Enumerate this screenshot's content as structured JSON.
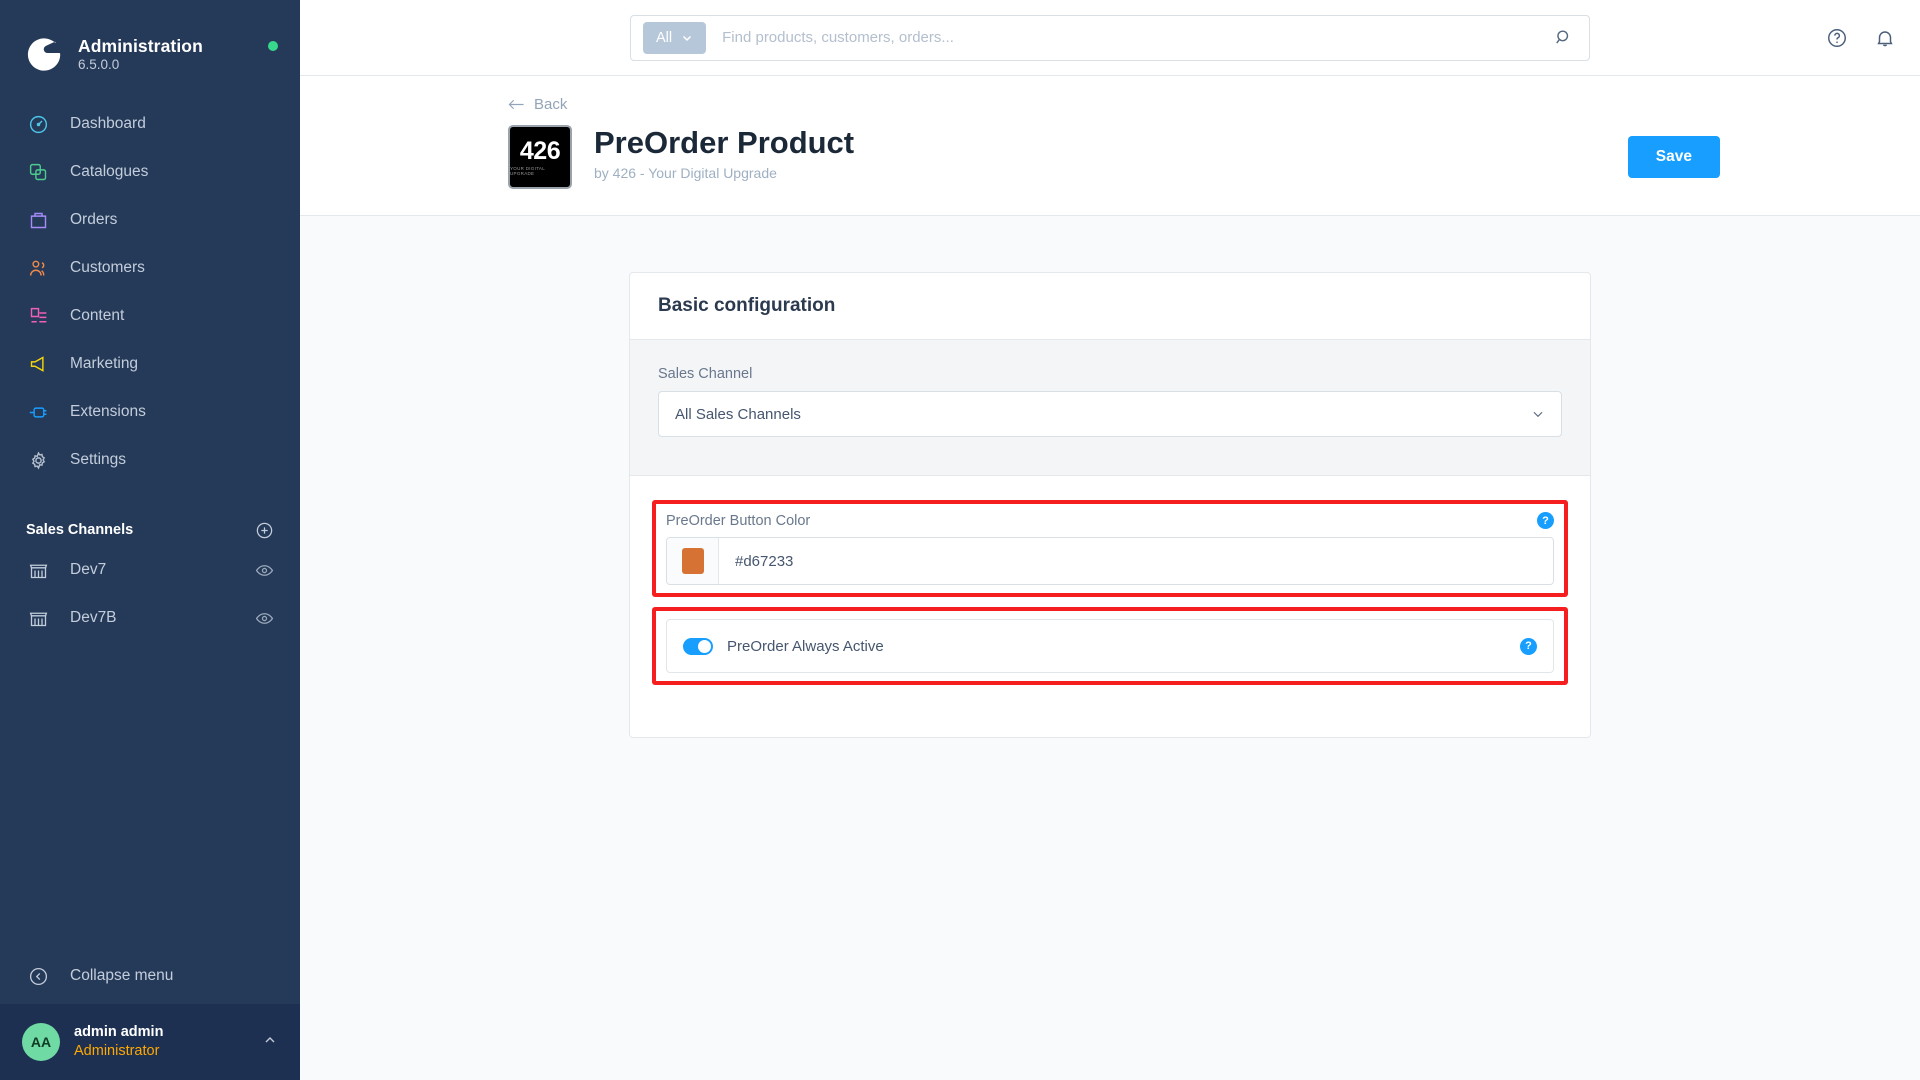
{
  "sidebar": {
    "brand": {
      "title": "Administration",
      "version": "6.5.0.0",
      "status_color": "#37d88c",
      "logo_icon": "shopware-logo-icon"
    },
    "items": [
      {
        "label": "Dashboard",
        "icon": "dashboard-icon",
        "color": "#4dc6e9"
      },
      {
        "label": "Catalogues",
        "icon": "catalogues-icon",
        "color": "#4ecb8e"
      },
      {
        "label": "Orders",
        "icon": "orders-icon",
        "color": "#a78bfa"
      },
      {
        "label": "Customers",
        "icon": "customers-icon",
        "color": "#f08a4b"
      },
      {
        "label": "Content",
        "icon": "content-icon",
        "color": "#f060b6"
      },
      {
        "label": "Marketing",
        "icon": "marketing-icon",
        "color": "#f5d60a"
      },
      {
        "label": "Extensions",
        "icon": "extensions-icon",
        "color": "#189eff"
      },
      {
        "label": "Settings",
        "icon": "gear-icon",
        "color": "#b6c1cf"
      }
    ],
    "section": {
      "label": "Sales Channels",
      "add_icon": "plus-circle-icon"
    },
    "channels": [
      {
        "label": "Dev7",
        "icon": "store-icon",
        "visibility_icon": "eye-icon"
      },
      {
        "label": "Dev7B",
        "icon": "store-icon",
        "visibility_icon": "eye-icon"
      }
    ],
    "collapse": {
      "label": "Collapse menu",
      "icon": "chevron-left-circle-icon"
    },
    "user": {
      "initials": "AA",
      "name": "admin admin",
      "role": "Administrator",
      "chevron_icon": "chevron-up-icon",
      "role_color": "#ffa800",
      "avatar_color": "#6fdaa4"
    }
  },
  "topbar": {
    "search": {
      "scope_label": "All",
      "scope_icon": "chevron-down-icon",
      "placeholder": "Find products, customers, orders...",
      "value": "",
      "submit_icon": "search-icon"
    },
    "actions": [
      {
        "name": "help-icon",
        "label": "Help"
      },
      {
        "name": "bell-icon",
        "label": "Notifications"
      }
    ]
  },
  "pageheader": {
    "back_label": "Back",
    "back_icon": "arrow-left-icon",
    "logo_number": "426",
    "logo_sub": "YOUR DIGITAL UPGRADE",
    "title": "PreOrder Product",
    "subtitle": "by 426 - Your Digital Upgrade",
    "save_label": "Save",
    "save_color": "#189eff"
  },
  "card": {
    "heading": "Basic configuration",
    "sales_channel": {
      "label": "Sales Channel",
      "value": "All Sales Channels",
      "chevron_icon": "chevron-down-icon"
    },
    "button_color": {
      "label": "PreOrder Button Color",
      "value": "#d67233",
      "swatch": "#d67233",
      "help_icon": "question-mark-icon",
      "highlight_color": "#f51f1f"
    },
    "always_active": {
      "label": "PreOrder Always Active",
      "enabled": true,
      "toggle_color": "#189eff",
      "help_icon": "question-mark-icon",
      "highlight_color": "#f51f1f"
    },
    "help_glyph": "?"
  }
}
